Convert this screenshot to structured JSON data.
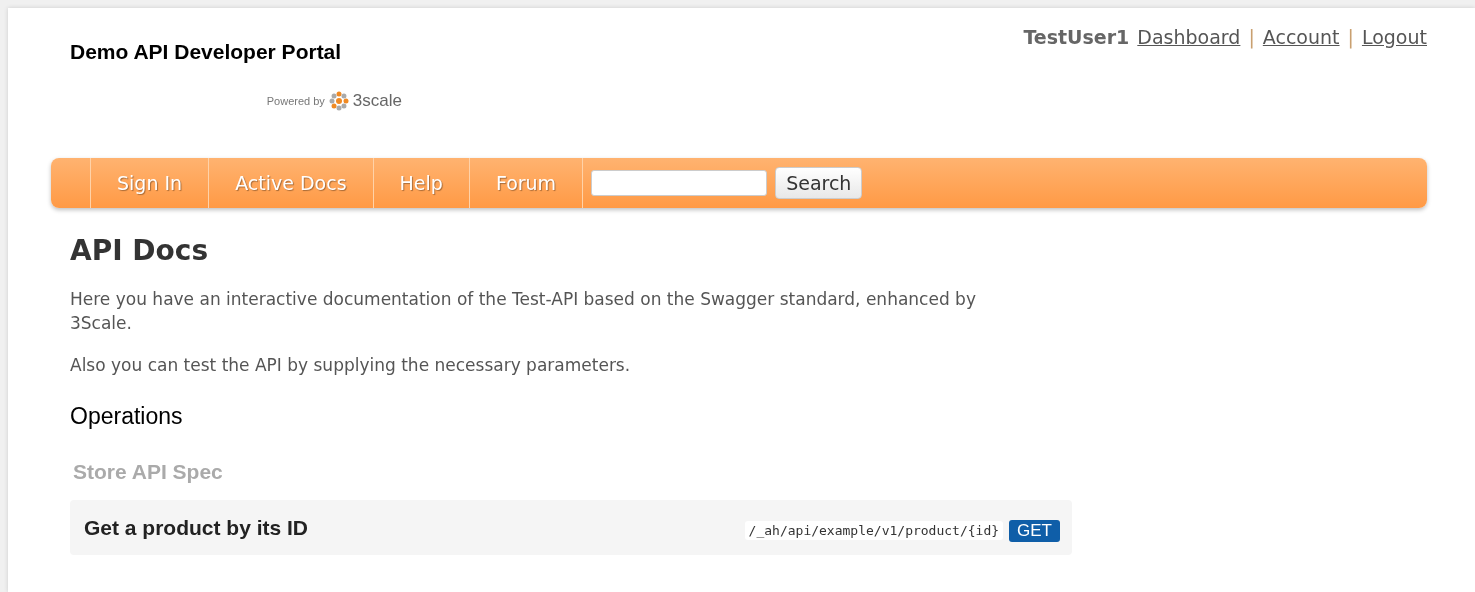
{
  "header": {
    "title": "Demo API Developer Portal",
    "powered_by": "Powered by",
    "brand": "3scale",
    "user": "TestUser1",
    "links": [
      {
        "label": "Dashboard"
      },
      {
        "label": "Account"
      },
      {
        "label": "Logout"
      }
    ],
    "separators": [
      "|",
      "|"
    ]
  },
  "nav": {
    "items": [
      {
        "label": "Sign In"
      },
      {
        "label": "Active Docs"
      },
      {
        "label": "Help"
      },
      {
        "label": "Forum"
      }
    ],
    "search_button": "Search"
  },
  "page": {
    "title": "API Docs",
    "paragraphs": [
      "Here you have an interactive documentation of the Test-API based on the Swagger standard, enhanced by 3Scale.",
      "Also you can test the API by supplying the necessary parameters."
    ],
    "section": "Operations",
    "spec": "Store API Spec",
    "operations": [
      {
        "summary": "Get a product by its ID",
        "path": "/_ah/api/example/v1/product/{id}",
        "method": "GET"
      }
    ]
  }
}
